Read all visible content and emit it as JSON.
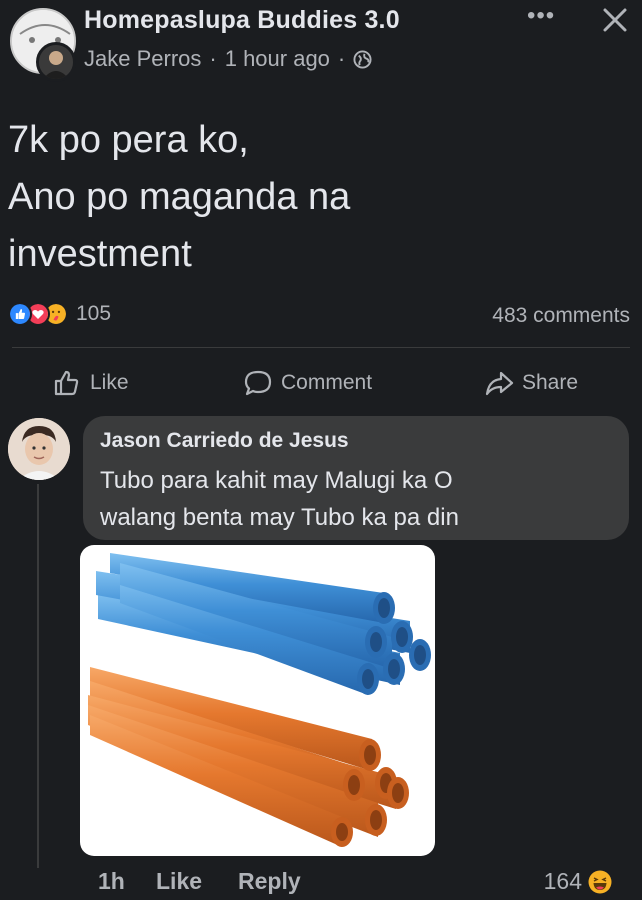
{
  "post": {
    "group_name": "Homepaslupa Buddies 3.0",
    "author": "Jake Perros",
    "separator": "·",
    "time": "1 hour ago",
    "lines": [
      "7k po pera ko,",
      "Ano po maganda na",
      "investment"
    ],
    "reaction_count": "105",
    "comments_count": "483 comments"
  },
  "actions": {
    "like": "Like",
    "comment": "Comment",
    "share": "Share"
  },
  "comment": {
    "author": "Jason Carriedo de Jesus",
    "lines": [
      "Tubo para kahit may Malugi ka O",
      "walang benta may Tubo ka pa din"
    ],
    "image": "pvc-pipes-image",
    "time": "1h",
    "like_label": "Like",
    "reply_label": "Reply",
    "reaction_count": "164"
  },
  "colors": {
    "background": "#1b1d20",
    "bubble": "#3a3b3c",
    "text_primary": "#e4e6eb",
    "text_secondary": "#b0b3b8",
    "like_blue": "#2d88ff",
    "love_red": "#f33e58",
    "pipe_blue": "#3f8fd6",
    "pipe_orange": "#e5782e"
  },
  "icons": [
    "globe-icon",
    "more-icon",
    "close-icon",
    "like-icon",
    "comment-icon",
    "share-icon",
    "haha-icon"
  ]
}
